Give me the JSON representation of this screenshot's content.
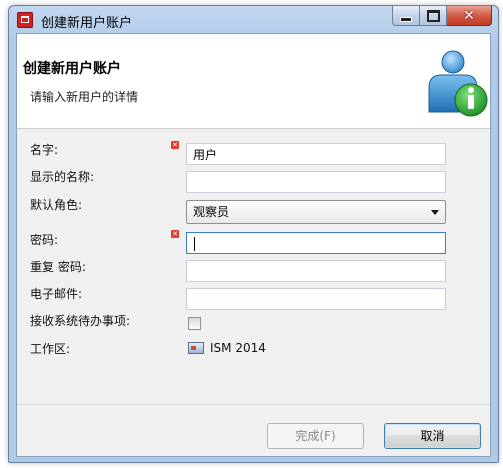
{
  "window": {
    "title": "创建新用户账户"
  },
  "caption": {
    "close_glyph": "✕"
  },
  "header": {
    "title": "创建新用户账户",
    "subtitle": "请输入新用户的详情",
    "icon": "user-info-icon"
  },
  "form": {
    "name": {
      "label": "名字:",
      "value": "用户",
      "required": true
    },
    "display_name": {
      "label": "显示的名称:",
      "value": ""
    },
    "default_role": {
      "label": "默认角色:",
      "selected": "观察员"
    },
    "password": {
      "label": "密码:",
      "value": "",
      "required": true
    },
    "repeat_password": {
      "label": "重复 密码:",
      "value": ""
    },
    "email": {
      "label": "电子邮件:",
      "value": ""
    },
    "todo": {
      "label": "接收系统待办事项:",
      "checked": false
    },
    "workspace": {
      "label": "工作区:",
      "value": "ISM 2014",
      "icon": "workspace-icon"
    }
  },
  "buttons": {
    "finish": "完成(F)",
    "cancel": "取消"
  },
  "required_mark": "✕",
  "colors": {
    "title_bar": "#aecae8",
    "close_button": "#c23b24",
    "required": "#e23b2e"
  }
}
